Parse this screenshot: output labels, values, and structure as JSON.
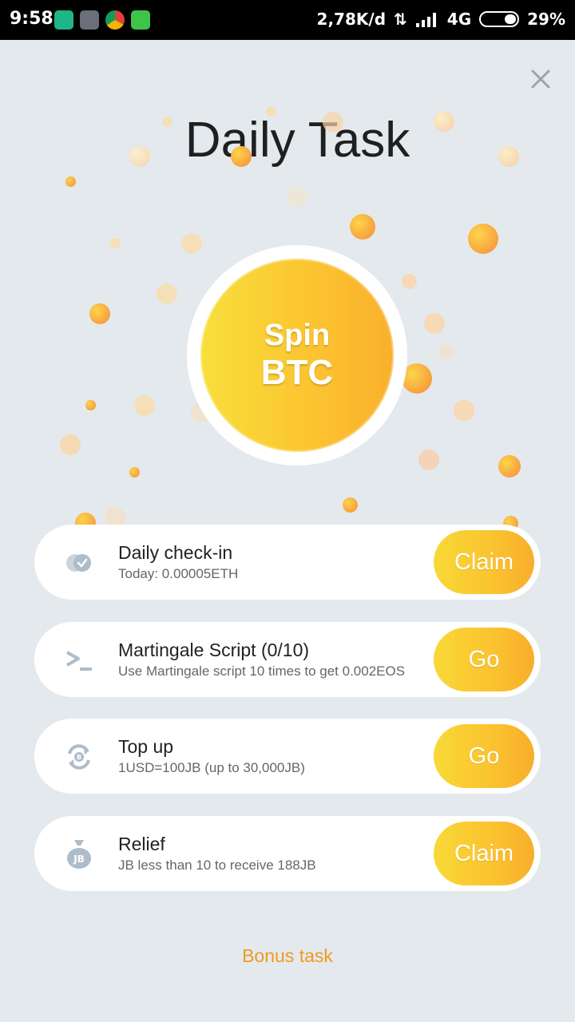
{
  "status_bar": {
    "time": "9:58",
    "network_speed": "2,78K/d",
    "network_type": "4G",
    "battery": "29%"
  },
  "header": {
    "title": "Daily Task"
  },
  "spin": {
    "line1": "Spin",
    "line2": "BTC"
  },
  "tasks": [
    {
      "icon": "check-circle-icon",
      "title": "Daily check-in",
      "subtitle": "Today: 0.00005ETH",
      "button": "Claim"
    },
    {
      "icon": "terminal-icon",
      "title": "Martingale Script (0/10)",
      "subtitle": "Use Martingale script 10 times to get 0.002EOS",
      "button": "Go"
    },
    {
      "icon": "exchange-icon",
      "title": "Top up",
      "subtitle": "1USD=100JB (up to 30,000JB)",
      "button": "Go"
    },
    {
      "icon": "money-bag-icon",
      "title": "Relief",
      "subtitle": "JB less than 10 to receive 188JB",
      "button": "Claim"
    }
  ],
  "footer": {
    "bonus_link": "Bonus task"
  },
  "colors": {
    "accent": "#fbc22f",
    "link": "#f09a1e",
    "background": "#e4e9ee"
  }
}
